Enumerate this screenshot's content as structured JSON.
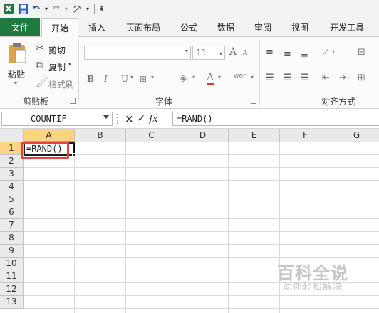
{
  "qat": {
    "excel_icon": "excel-logo-icon",
    "save_icon": "save-icon",
    "undo_icon": "undo-icon",
    "redo_icon": "redo-icon",
    "customize_icon": "customize-icon"
  },
  "tabs": [
    {
      "label": "文件"
    },
    {
      "label": "开始"
    },
    {
      "label": "插入"
    },
    {
      "label": "页面布局"
    },
    {
      "label": "公式"
    },
    {
      "label": "数据"
    },
    {
      "label": "审阅"
    },
    {
      "label": "视图"
    },
    {
      "label": "开发工具"
    }
  ],
  "ribbon": {
    "clipboard": {
      "paste": "粘贴",
      "cut": "剪切",
      "copy": "复制",
      "format_painter": "格式刷",
      "group_label": "剪贴板"
    },
    "font": {
      "font_name": "",
      "font_size": "11",
      "bold": "B",
      "italic": "I",
      "underline": "U",
      "grow": "A",
      "shrink": "A",
      "font_color": "A",
      "phonetic": "wén",
      "group_label": "字体"
    },
    "alignment": {
      "group_label": "对齐方式"
    }
  },
  "formula_bar": {
    "name_box": "COUNTIF",
    "cancel": "×",
    "enter": "✓",
    "fx": "fx",
    "formula": "=RAND()"
  },
  "grid": {
    "columns": [
      "A",
      "B",
      "C",
      "D",
      "E",
      "F",
      "G"
    ],
    "rows": [
      "1",
      "2",
      "3",
      "4",
      "5",
      "6",
      "7",
      "8",
      "9",
      "10",
      "11",
      "12",
      "13"
    ],
    "active_cell_text": "=RAND()"
  },
  "watermark": {
    "title": "百科全说",
    "subtitle": "助你轻松解决"
  },
  "colors": {
    "file_tab": "#1f7a3f",
    "selected_header": "#fbd583",
    "highlight_box": "#e84040"
  }
}
